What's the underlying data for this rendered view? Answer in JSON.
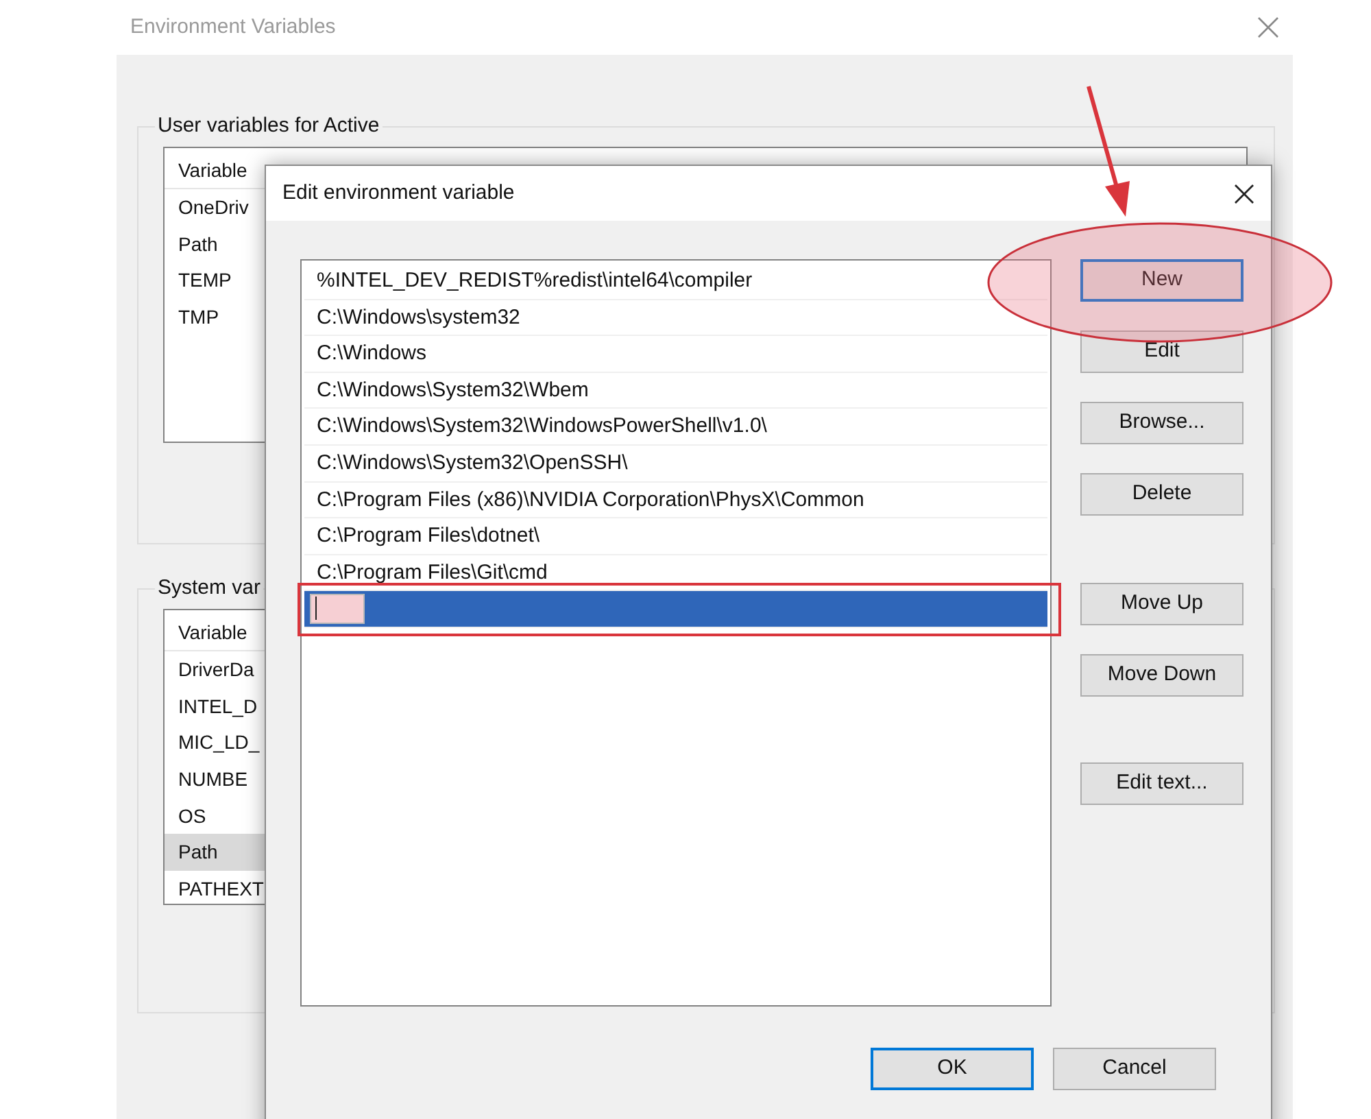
{
  "background_window": {
    "title": "Environment Variables",
    "groups": [
      {
        "label": "User variables for Active",
        "column": "Variable",
        "rows": [
          {
            "name": "OneDriv",
            "selected": false
          },
          {
            "name": "Path",
            "selected": false
          },
          {
            "name": "TEMP",
            "selected": false
          },
          {
            "name": "TMP",
            "selected": false
          }
        ]
      },
      {
        "label": "System var",
        "column": "Variable",
        "rows": [
          {
            "name": "DriverDa",
            "selected": false
          },
          {
            "name": "INTEL_D",
            "selected": false
          },
          {
            "name": "MIC_LD_",
            "selected": false
          },
          {
            "name": "NUMBE",
            "selected": false
          },
          {
            "name": "OS",
            "selected": false
          },
          {
            "name": "Path",
            "selected": true
          },
          {
            "name": "PATHEXT",
            "selected": false
          }
        ]
      }
    ]
  },
  "dialog": {
    "title": "Edit environment variable",
    "entries": [
      {
        "kind": "text",
        "text": "%INTEL_DEV_REDIST%redist\\intel64\\compiler",
        "selected": false
      },
      {
        "kind": "text",
        "text": "C:\\Windows\\system32",
        "selected": false
      },
      {
        "kind": "text",
        "text": "C:\\Windows",
        "selected": false
      },
      {
        "kind": "text",
        "text": "C:\\Windows\\System32\\Wbem",
        "selected": false
      },
      {
        "kind": "text",
        "text": "C:\\Windows\\System32\\WindowsPowerShell\\v1.0\\",
        "selected": false
      },
      {
        "kind": "text",
        "text": "C:\\Windows\\System32\\OpenSSH\\",
        "selected": false
      },
      {
        "kind": "text",
        "text": "C:\\Program Files (x86)\\NVIDIA Corporation\\PhysX\\Common",
        "selected": false
      },
      {
        "kind": "text",
        "text": "C:\\Program Files\\dotnet\\",
        "selected": false
      },
      {
        "kind": "text",
        "text": "C:\\Program Files\\Git\\cmd",
        "selected": false
      },
      {
        "kind": "input",
        "selected": true
      }
    ],
    "button_groups": [
      [
        {
          "label": "New",
          "focused": true
        },
        {
          "label": "Edit",
          "focused": false
        },
        {
          "label": "Browse...",
          "focused": false
        },
        {
          "label": "Delete",
          "focused": false
        }
      ],
      [
        {
          "label": "Move Up",
          "focused": false
        },
        {
          "label": "Move Down",
          "focused": false
        }
      ],
      [
        {
          "label": "Edit text...",
          "focused": false
        }
      ]
    ],
    "footer_buttons": [
      {
        "label": "OK",
        "default": true
      },
      {
        "label": "Cancel",
        "default": false
      }
    ]
  },
  "annotations": [
    {
      "kind": "arrow"
    },
    {
      "kind": "ellipse"
    },
    {
      "kind": "rectangle"
    }
  ]
}
